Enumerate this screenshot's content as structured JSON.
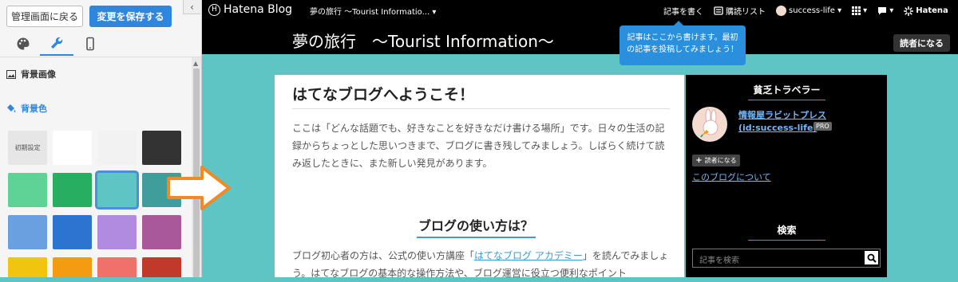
{
  "sidebar": {
    "back_label": "管理画面に戻る",
    "save_label": "変更を保存する",
    "collapse_glyph": "‹",
    "tabs": [
      "design-icon",
      "customize-icon",
      "smartphone-icon"
    ],
    "bg_image_label": "背景画像",
    "bg_color_label": "背景色",
    "swatches": [
      {
        "label": "初期設定",
        "color": "#e6e6e6"
      },
      {
        "label": "",
        "color": "#ffffff"
      },
      {
        "label": "",
        "color": "#f2f2f2"
      },
      {
        "label": "",
        "color": "#333333"
      },
      {
        "label": "",
        "color": "#5fd395"
      },
      {
        "label": "",
        "color": "#27ae60"
      },
      {
        "label": "",
        "color": "#5ec4c4",
        "selected": true
      },
      {
        "label": "",
        "color": "#3f9e9b"
      },
      {
        "label": "",
        "color": "#6a9fe0"
      },
      {
        "label": "",
        "color": "#2d73d0"
      },
      {
        "label": "",
        "color": "#b18be0"
      },
      {
        "label": "",
        "color": "#a9589a"
      },
      {
        "label": "",
        "color": "#f1c40f"
      },
      {
        "label": "",
        "color": "#f39c12"
      },
      {
        "label": "",
        "color": "#f0706a"
      },
      {
        "label": "",
        "color": "#c0392b"
      }
    ]
  },
  "topbar": {
    "logo": "Hatena Blog",
    "blog_selector": "夢の旅行 〜Tourist Informatio... ▾",
    "write_label": "記事を書く",
    "reading_list_label": "購読リスト",
    "user_label": "success-life ▾",
    "grid_glyph": "▾",
    "notify_glyph": "▾",
    "hatena_label": "Hatena"
  },
  "header": {
    "title": "夢の旅行　〜Tourist Information〜",
    "reader_button": "読者になる"
  },
  "tooltip": "記事はここから書けます。最初の記事を投稿してみましょう！",
  "article": {
    "title": "はてなブログへようこそ！",
    "intro": "ここは「どんな話題でも、好きなことを好きなだけ書ける場所」です。日々の生活の記録からちょっとした思いつきまで、ブログに書き残してみましょう。しばらく続けて読み返したときに、また新しい発見があります。",
    "h2": "ブログの使い方は？",
    "para2_pre": "ブログ初心者の方は、公式の使い方講座「",
    "para2_link": "はてなブログ アカデミー",
    "para2_post": "」を読んでみましょう。はてなブログの基本的な操作方法や、ブログ運営に役立つ便利なポイント"
  },
  "profile": {
    "heading": "貧乏トラベラー",
    "name": "情報屋ラビットプレス",
    "id": "(id:success-life)",
    "pro_badge": "PRO",
    "follow_label": "読者になる",
    "about_link": "このブログについて"
  },
  "search": {
    "heading": "検索",
    "placeholder": "記事を検索"
  }
}
